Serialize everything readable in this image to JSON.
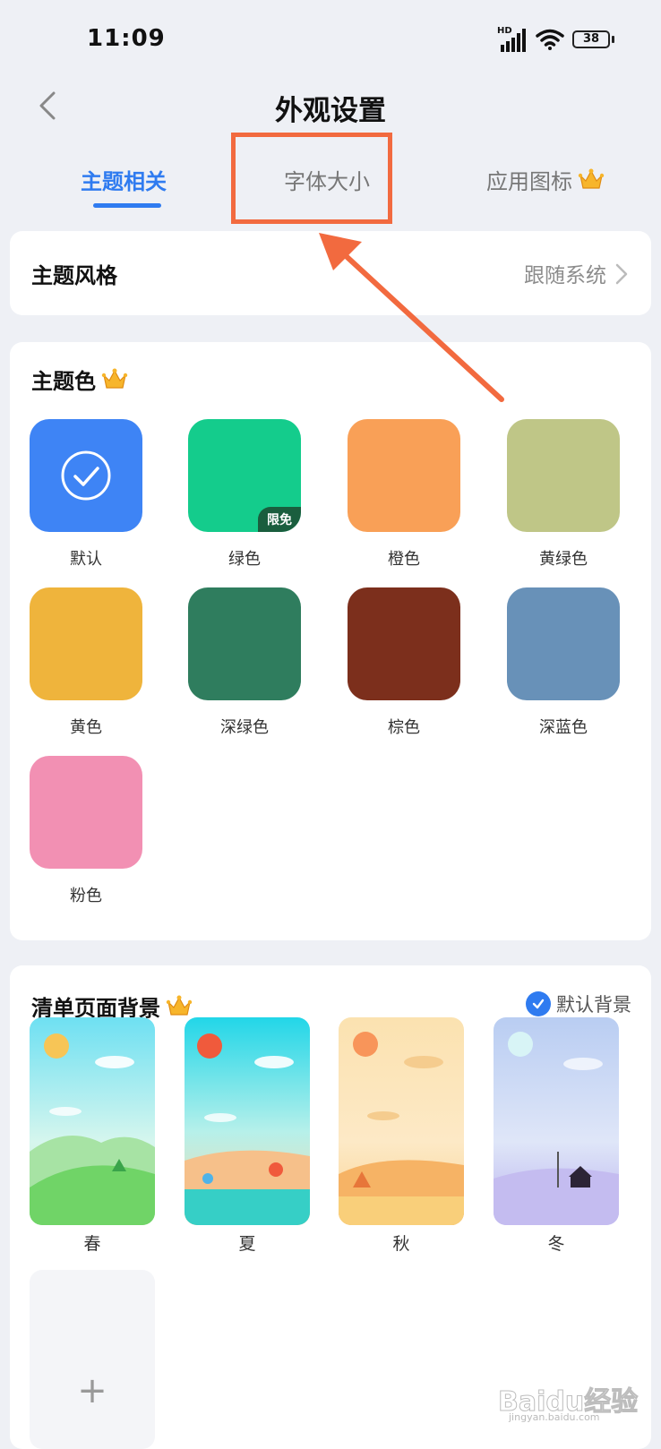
{
  "status_bar": {
    "time": "11:09",
    "network": "HD",
    "battery": "38"
  },
  "header": {
    "title": "外观设置"
  },
  "tabs": [
    {
      "label": "主题相关",
      "active": true
    },
    {
      "label": "字体大小",
      "active": false
    },
    {
      "label": "应用图标",
      "active": false,
      "icon": "crown-icon"
    }
  ],
  "theme_style": {
    "label": "主题风格",
    "value": "跟随系统"
  },
  "theme_color": {
    "title": "主题色",
    "title_icon": "crown-icon",
    "swatches": [
      {
        "label": "默认",
        "color": "#3e84f5",
        "selected": true
      },
      {
        "label": "绿色",
        "color": "#14cc8c",
        "badge": "限免"
      },
      {
        "label": "橙色",
        "color": "#f9a057"
      },
      {
        "label": "黄绿色",
        "color": "#bfc687"
      },
      {
        "label": "黄色",
        "color": "#efb43c"
      },
      {
        "label": "深绿色",
        "color": "#2f7d5e"
      },
      {
        "label": "棕色",
        "color": "#7c2f1c"
      },
      {
        "label": "深蓝色",
        "color": "#6891b8"
      },
      {
        "label": "粉色",
        "color": "#f290b3"
      }
    ]
  },
  "list_background": {
    "title": "清单页面背景",
    "title_icon": "crown-icon",
    "default_label": "默认背景",
    "items": [
      {
        "label": "春"
      },
      {
        "label": "夏"
      },
      {
        "label": "秋"
      },
      {
        "label": "冬"
      }
    ],
    "add_label": "+"
  },
  "watermark": {
    "logo": "Baidu经验",
    "sub": "jingyan.baidu.com"
  },
  "colors": {
    "accent": "#2f7bf0",
    "highlight": "#f26a3f",
    "background": "#eef0f5"
  }
}
